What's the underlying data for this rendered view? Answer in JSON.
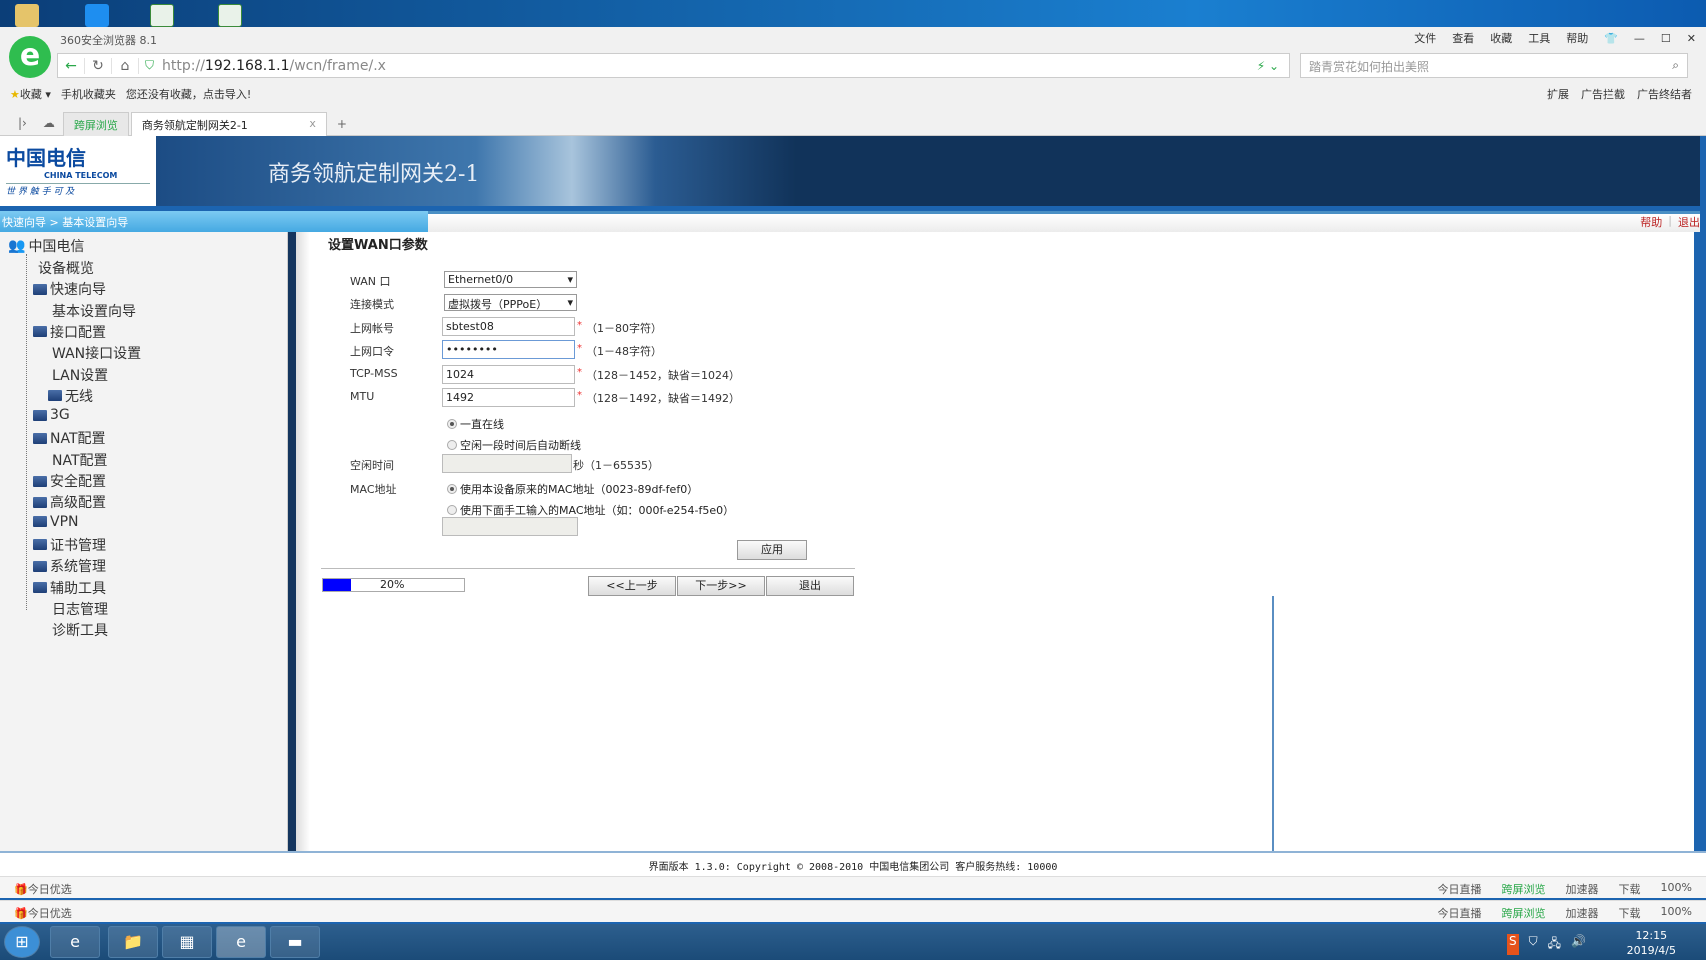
{
  "browser": {
    "app_name": "360安全浏览器 8.1",
    "menu": [
      "文件",
      "查看",
      "收藏",
      "工具",
      "帮助"
    ],
    "url_prefix": "http://",
    "url_host": "192.168.1.1",
    "url_path": "/wcn/frame/.x",
    "search_placeholder": "踏青赏花如何拍出美照",
    "bookmarks": {
      "fav": "收藏",
      "mobile": "手机收藏夹",
      "empty": "您还没有收藏，点击导入!"
    },
    "toolbar_right": [
      "扩展",
      "广告拦截",
      "广告终结者"
    ],
    "tabs": [
      {
        "label": "跨屏浏览"
      },
      {
        "label": "商务领航定制网关2-1"
      }
    ],
    "new_tab": "+",
    "tab_close": "x"
  },
  "header": {
    "brand_cn": "中国电信",
    "brand_en": "CHINA TELECOM",
    "slogan": "世 界 触 手 可 及",
    "title": "商务领航定制网关2-1",
    "help": "帮助",
    "logout": "退出"
  },
  "breadcrumb": {
    "items": [
      "快速向导",
      "基本设置向导"
    ],
    "sep": ">"
  },
  "sidebar": {
    "root": "中国电信",
    "items": [
      {
        "label": "设备概览",
        "level": 1,
        "folder": false
      },
      {
        "label": "快速向导",
        "level": 1,
        "folder": true
      },
      {
        "label": "基本设置向导",
        "level": 2,
        "folder": false
      },
      {
        "label": "接口配置",
        "level": 1,
        "folder": true
      },
      {
        "label": "WAN接口设置",
        "level": 2,
        "folder": false
      },
      {
        "label": "LAN设置",
        "level": 2,
        "folder": false
      },
      {
        "label": "无线",
        "level": 2,
        "folder": true
      },
      {
        "label": "3G",
        "level": 1,
        "folder": true
      },
      {
        "label": "NAT配置",
        "level": 1,
        "folder": true
      },
      {
        "label": "NAT配置",
        "level": 2,
        "folder": false
      },
      {
        "label": "安全配置",
        "level": 1,
        "folder": true
      },
      {
        "label": "高级配置",
        "level": 1,
        "folder": true
      },
      {
        "label": "VPN",
        "level": 1,
        "folder": true
      },
      {
        "label": "证书管理",
        "level": 1,
        "folder": true
      },
      {
        "label": "系统管理",
        "level": 1,
        "folder": true
      },
      {
        "label": "辅助工具",
        "level": 1,
        "folder": true
      },
      {
        "label": "日志管理",
        "level": 2,
        "folder": false
      },
      {
        "label": "诊断工具",
        "level": 2,
        "folder": false
      }
    ]
  },
  "form": {
    "title": "设置WAN口参数",
    "wan_label": "WAN 口",
    "wan_value": "Ethernet0/0",
    "mode_label": "连接模式",
    "mode_value": "虚拟拨号（PPPoE）",
    "account_label": "上网帐号",
    "account_value": "sbtest08",
    "account_hint": "（1－80字符）",
    "password_label": "上网口令",
    "password_value": "••••••••",
    "password_hint": "（1－48字符）",
    "mss_label": "TCP-MSS",
    "mss_value": "1024",
    "mss_hint": "（128－1452，缺省＝1024）",
    "mtu_label": "MTU",
    "mtu_value": "1492",
    "mtu_hint": "（128－1492，缺省＝1492）",
    "online_always": "一直在线",
    "online_idle": "空闲一段时间后自动断线",
    "online_selected": "always",
    "idle_label": "空闲时间",
    "idle_value": "",
    "idle_hint": "秒（1－65535）",
    "mac_label": "MAC地址",
    "mac_original": "使用本设备原来的MAC地址（0023-89df-fef0）",
    "mac_manual": "使用下面手工输入的MAC地址（如：000f-e254-f5e0）",
    "mac_selected": "original",
    "mac_value": "",
    "apply": "应用",
    "prev": "<<上一步",
    "next": "下一步>>",
    "exit": "退出",
    "progress_percent": 20,
    "progress_text": "20%"
  },
  "footer": {
    "text": "界面版本 1.3.0: Copyright © 2008-2010 中国电信集团公司 客户服务热线: 10000"
  },
  "statusbar": {
    "left": "今日优选",
    "live": "今日直播",
    "cross": "跨屏浏览",
    "accel": "加速器",
    "download": "下载",
    "zoom": "100%"
  },
  "taskbar": {
    "time": "12:15",
    "date": "2019/4/5"
  },
  "colors": {
    "brand_dark": "#11335a",
    "progress": "#0000ff",
    "link_red": "#b22222"
  }
}
